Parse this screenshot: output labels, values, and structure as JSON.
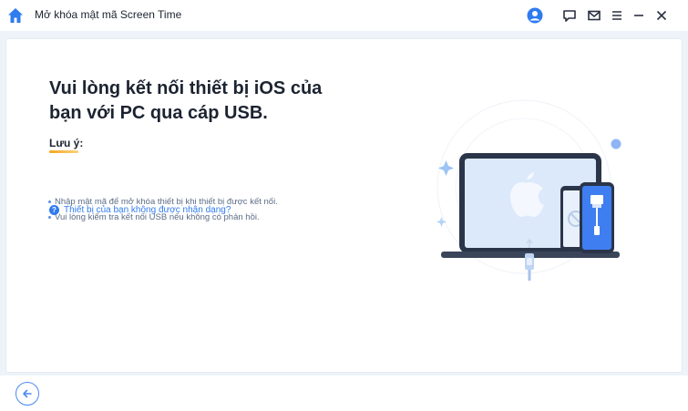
{
  "window": {
    "title": "Mở khóa mật mã Screen Time",
    "icons": [
      "home-icon",
      "user-icon",
      "feedback-icon",
      "mail-icon",
      "menu-icon",
      "minimize-icon",
      "close-icon"
    ]
  },
  "main": {
    "heading": "Vui lòng kết nối thiết bị iOS của bạn với PC qua cáp USB.",
    "note_label": "Lưu ý:",
    "notes": [
      "Nhập mật mã để mở khóa thiết bị khi thiết bị được kết nối.",
      "Vui lòng kiểm tra kết nối USB nếu không có phản hồi."
    ],
    "help_link": "Thiết bị của bạn không được nhận dạng?"
  },
  "footer": {
    "back_icon": "arrow-left-icon"
  },
  "colors": {
    "accent": "#2f7bf0",
    "background": "#eef3fa",
    "note_underline": "#f5a623"
  }
}
